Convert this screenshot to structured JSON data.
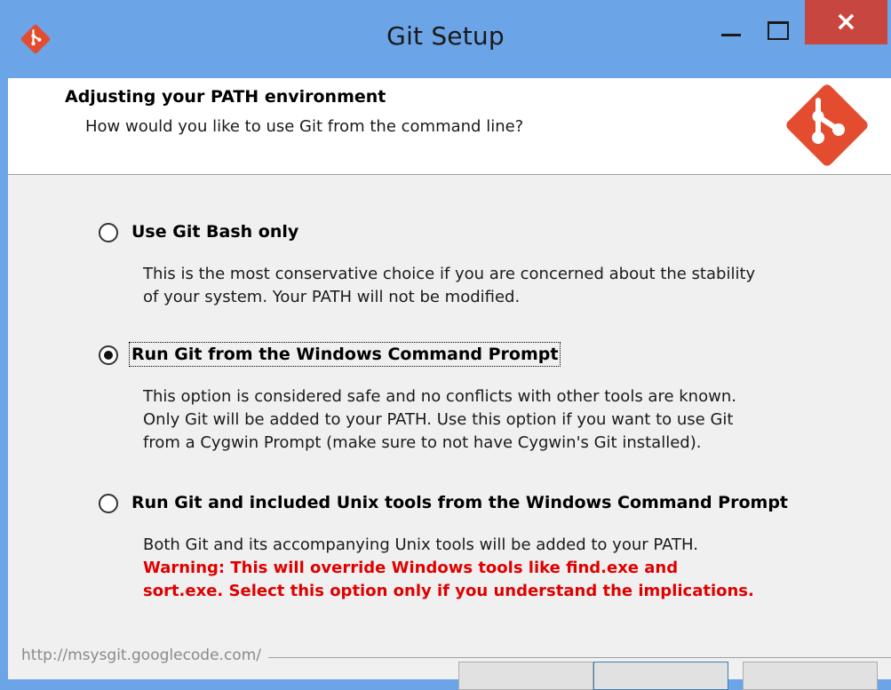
{
  "window": {
    "title": "Git Setup",
    "close_glyph": "×"
  },
  "header": {
    "title": "Adjusting your PATH environment",
    "subtitle": "How would you like to use Git from the command line?"
  },
  "options": [
    {
      "label": "Use Git Bash only",
      "selected": false,
      "description": [
        "This is the most conservative choice if you are concerned about the stability",
        "of your system. Your PATH will not be modified."
      ]
    },
    {
      "label": "Run Git from the Windows Command Prompt",
      "selected": true,
      "description": [
        "This option is considered safe and no conflicts with other tools are known.",
        "Only Git will be added to your PATH. Use this option if you want to use Git",
        "from a Cygwin Prompt (make sure to not have Cygwin's Git installed)."
      ]
    },
    {
      "label": "Run Git and included Unix tools from the Windows Command Prompt",
      "selected": false,
      "description": [
        "Both Git and its accompanying Unix tools will be added to your PATH."
      ],
      "warning": [
        "Warning: This will override Windows tools like find.exe and",
        "sort.exe. Select this option only if you understand the implications."
      ]
    }
  ],
  "footer": {
    "url": "http://msysgit.googlecode.com/"
  },
  "colors": {
    "titlebar": "#6ba4e7",
    "close_button": "#c7463f",
    "git_logo": "#e44c30",
    "warning_text": "#e00000"
  },
  "icons": {
    "title_logo": "git-logo-icon",
    "header_logo": "git-logo-icon"
  }
}
